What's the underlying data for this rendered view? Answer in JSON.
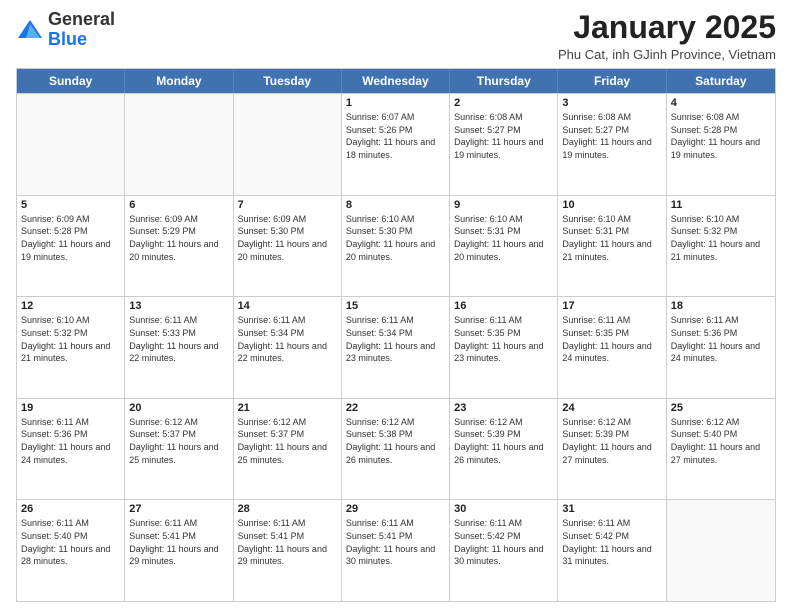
{
  "header": {
    "logo": {
      "general": "General",
      "blue": "Blue"
    },
    "title": "January 2025",
    "subtitle": "Phu Cat, inh GJinh Province, Vietnam"
  },
  "calendar": {
    "days_of_week": [
      "Sunday",
      "Monday",
      "Tuesday",
      "Wednesday",
      "Thursday",
      "Friday",
      "Saturday"
    ],
    "weeks": [
      [
        {
          "day": "",
          "info": "",
          "empty": true
        },
        {
          "day": "",
          "info": "",
          "empty": true
        },
        {
          "day": "",
          "info": "",
          "empty": true
        },
        {
          "day": "1",
          "info": "Sunrise: 6:07 AM\nSunset: 5:26 PM\nDaylight: 11 hours and 18 minutes."
        },
        {
          "day": "2",
          "info": "Sunrise: 6:08 AM\nSunset: 5:27 PM\nDaylight: 11 hours and 19 minutes."
        },
        {
          "day": "3",
          "info": "Sunrise: 6:08 AM\nSunset: 5:27 PM\nDaylight: 11 hours and 19 minutes."
        },
        {
          "day": "4",
          "info": "Sunrise: 6:08 AM\nSunset: 5:28 PM\nDaylight: 11 hours and 19 minutes."
        }
      ],
      [
        {
          "day": "5",
          "info": "Sunrise: 6:09 AM\nSunset: 5:28 PM\nDaylight: 11 hours and 19 minutes."
        },
        {
          "day": "6",
          "info": "Sunrise: 6:09 AM\nSunset: 5:29 PM\nDaylight: 11 hours and 20 minutes."
        },
        {
          "day": "7",
          "info": "Sunrise: 6:09 AM\nSunset: 5:30 PM\nDaylight: 11 hours and 20 minutes."
        },
        {
          "day": "8",
          "info": "Sunrise: 6:10 AM\nSunset: 5:30 PM\nDaylight: 11 hours and 20 minutes."
        },
        {
          "day": "9",
          "info": "Sunrise: 6:10 AM\nSunset: 5:31 PM\nDaylight: 11 hours and 20 minutes."
        },
        {
          "day": "10",
          "info": "Sunrise: 6:10 AM\nSunset: 5:31 PM\nDaylight: 11 hours and 21 minutes."
        },
        {
          "day": "11",
          "info": "Sunrise: 6:10 AM\nSunset: 5:32 PM\nDaylight: 11 hours and 21 minutes."
        }
      ],
      [
        {
          "day": "12",
          "info": "Sunrise: 6:10 AM\nSunset: 5:32 PM\nDaylight: 11 hours and 21 minutes."
        },
        {
          "day": "13",
          "info": "Sunrise: 6:11 AM\nSunset: 5:33 PM\nDaylight: 11 hours and 22 minutes."
        },
        {
          "day": "14",
          "info": "Sunrise: 6:11 AM\nSunset: 5:34 PM\nDaylight: 11 hours and 22 minutes."
        },
        {
          "day": "15",
          "info": "Sunrise: 6:11 AM\nSunset: 5:34 PM\nDaylight: 11 hours and 23 minutes."
        },
        {
          "day": "16",
          "info": "Sunrise: 6:11 AM\nSunset: 5:35 PM\nDaylight: 11 hours and 23 minutes."
        },
        {
          "day": "17",
          "info": "Sunrise: 6:11 AM\nSunset: 5:35 PM\nDaylight: 11 hours and 24 minutes."
        },
        {
          "day": "18",
          "info": "Sunrise: 6:11 AM\nSunset: 5:36 PM\nDaylight: 11 hours and 24 minutes."
        }
      ],
      [
        {
          "day": "19",
          "info": "Sunrise: 6:11 AM\nSunset: 5:36 PM\nDaylight: 11 hours and 24 minutes."
        },
        {
          "day": "20",
          "info": "Sunrise: 6:12 AM\nSunset: 5:37 PM\nDaylight: 11 hours and 25 minutes."
        },
        {
          "day": "21",
          "info": "Sunrise: 6:12 AM\nSunset: 5:37 PM\nDaylight: 11 hours and 25 minutes."
        },
        {
          "day": "22",
          "info": "Sunrise: 6:12 AM\nSunset: 5:38 PM\nDaylight: 11 hours and 26 minutes."
        },
        {
          "day": "23",
          "info": "Sunrise: 6:12 AM\nSunset: 5:39 PM\nDaylight: 11 hours and 26 minutes."
        },
        {
          "day": "24",
          "info": "Sunrise: 6:12 AM\nSunset: 5:39 PM\nDaylight: 11 hours and 27 minutes."
        },
        {
          "day": "25",
          "info": "Sunrise: 6:12 AM\nSunset: 5:40 PM\nDaylight: 11 hours and 27 minutes."
        }
      ],
      [
        {
          "day": "26",
          "info": "Sunrise: 6:11 AM\nSunset: 5:40 PM\nDaylight: 11 hours and 28 minutes."
        },
        {
          "day": "27",
          "info": "Sunrise: 6:11 AM\nSunset: 5:41 PM\nDaylight: 11 hours and 29 minutes."
        },
        {
          "day": "28",
          "info": "Sunrise: 6:11 AM\nSunset: 5:41 PM\nDaylight: 11 hours and 29 minutes."
        },
        {
          "day": "29",
          "info": "Sunrise: 6:11 AM\nSunset: 5:41 PM\nDaylight: 11 hours and 30 minutes."
        },
        {
          "day": "30",
          "info": "Sunrise: 6:11 AM\nSunset: 5:42 PM\nDaylight: 11 hours and 30 minutes."
        },
        {
          "day": "31",
          "info": "Sunrise: 6:11 AM\nSunset: 5:42 PM\nDaylight: 11 hours and 31 minutes."
        },
        {
          "day": "",
          "info": "",
          "empty": true
        }
      ]
    ]
  }
}
